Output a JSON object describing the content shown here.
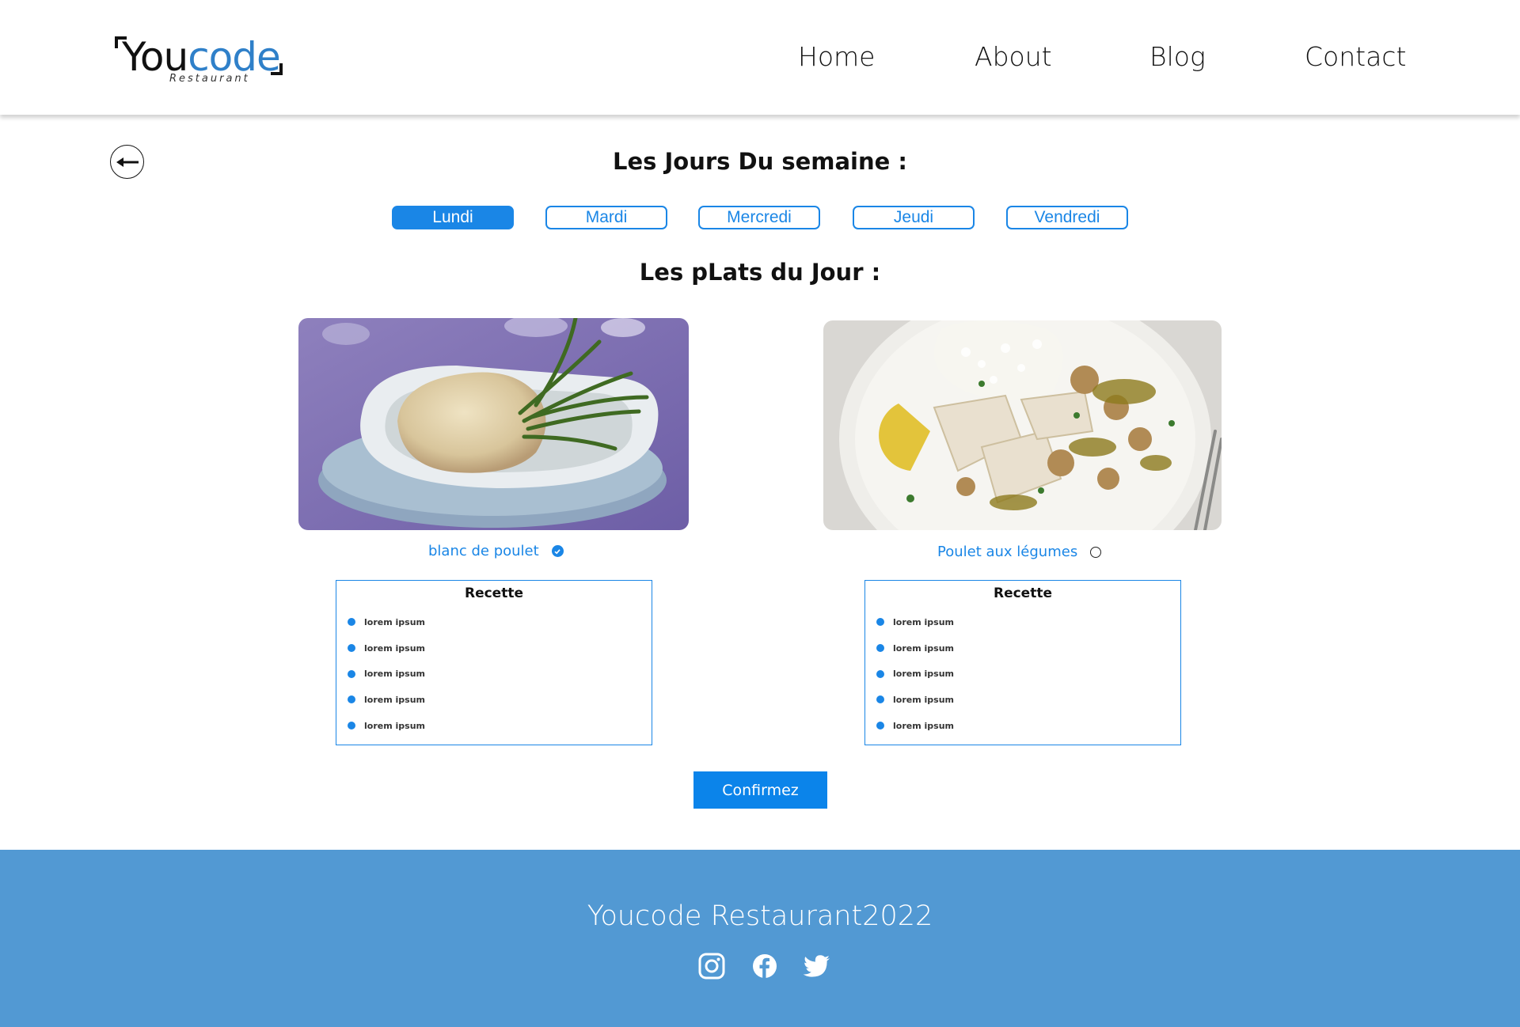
{
  "header": {
    "logo": {
      "word_dark": "You",
      "word_blue": "code",
      "subtitle": "Restaurant"
    },
    "nav": [
      "Home",
      "About",
      "Blog",
      "Contact"
    ]
  },
  "main": {
    "days_title": "Les Jours Du semaine :",
    "days": [
      {
        "label": "Lundi",
        "active": true
      },
      {
        "label": "Mardi",
        "active": false
      },
      {
        "label": "Mercredi",
        "active": false
      },
      {
        "label": "Jeudi",
        "active": false
      },
      {
        "label": "Vendredi",
        "active": false
      }
    ],
    "dishes_title": "Les pLats du Jour :",
    "dishes": [
      {
        "name": "blanc de poulet",
        "selected": true,
        "recipe_title": "Recette",
        "ingredients": [
          "lorem ipsum",
          "lorem ipsum",
          "lorem ipsum",
          "lorem ipsum",
          "lorem ipsum"
        ]
      },
      {
        "name": "Poulet aux légumes",
        "selected": false,
        "recipe_title": "Recette",
        "ingredients": [
          "lorem ipsum",
          "lorem ipsum",
          "lorem ipsum",
          "lorem ipsum",
          "lorem ipsum"
        ]
      }
    ],
    "confirm_label": "Confirmez"
  },
  "footer": {
    "text": "Youcode Restaurant2022",
    "social_icons": [
      "instagram-icon",
      "facebook-icon",
      "twitter-icon"
    ]
  },
  "colors": {
    "accent": "#1a86e6",
    "footer_bg": "#5299d3",
    "logo_blue": "#2f80c9"
  }
}
